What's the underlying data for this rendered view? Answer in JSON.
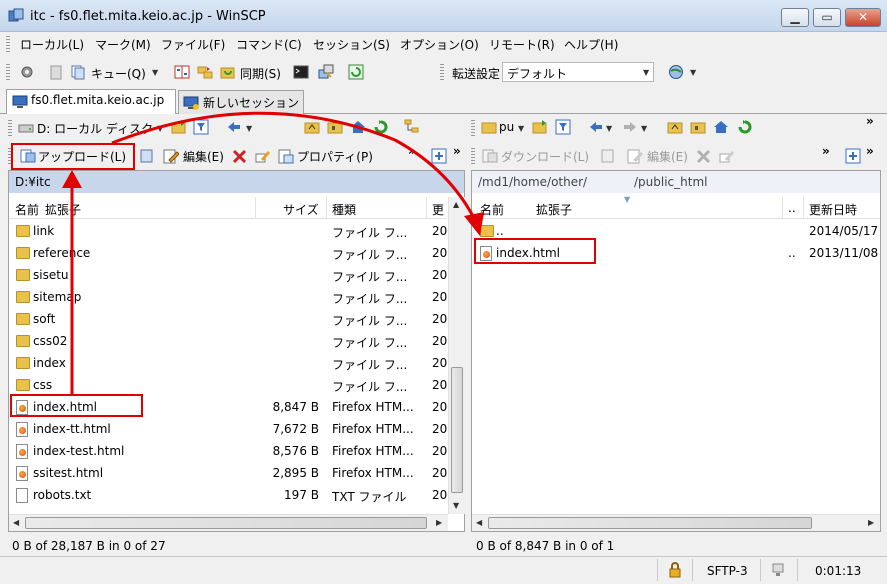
{
  "window": {
    "title": "itc - fs0.flet.mita.keio.ac.jp - WinSCP",
    "min_label": "▁",
    "max_label": "▭",
    "close_label": "✕"
  },
  "menu": [
    "ローカル(L)",
    "マーク(M)",
    "ファイル(F)",
    "コマンド(C)",
    "セッション(S)",
    "オプション(O)",
    "リモート(R)",
    "ヘルプ(H)"
  ],
  "toolbar": {
    "queue_label": "キュー(Q)",
    "sync_label": "同期(S)",
    "transfer_label": "転送設定",
    "transfer_value": "デフォルト"
  },
  "tabs": {
    "session": "fs0.flet.mita.keio.ac.jp",
    "new_session": "新しいセッション"
  },
  "local": {
    "drive": "D: ローカル ディスク",
    "upload_label": "アップロード(L)",
    "edit_label": "編集(E)",
    "props_label": "プロパティ(P)",
    "path": "D:¥itc",
    "columns": {
      "name": "名前",
      "ext": "拡張子",
      "size": "サイズ",
      "type": "種類",
      "changed": "更"
    },
    "files": [
      {
        "name": "link",
        "size": "",
        "type": "ファイル フ...",
        "changed": "20",
        "icon": "folder"
      },
      {
        "name": "reference",
        "size": "",
        "type": "ファイル フ...",
        "changed": "20",
        "icon": "folder"
      },
      {
        "name": "sisetu",
        "size": "",
        "type": "ファイル フ...",
        "changed": "20",
        "icon": "folder"
      },
      {
        "name": "sitemap",
        "size": "",
        "type": "ファイル フ...",
        "changed": "20",
        "icon": "folder"
      },
      {
        "name": "soft",
        "size": "",
        "type": "ファイル フ...",
        "changed": "20",
        "icon": "folder"
      },
      {
        "name": "css02",
        "size": "",
        "type": "ファイル フ...",
        "changed": "20",
        "icon": "folder"
      },
      {
        "name": "index",
        "size": "",
        "type": "ファイル フ...",
        "changed": "20",
        "icon": "folder"
      },
      {
        "name": "css",
        "size": "",
        "type": "ファイル フ...",
        "changed": "20",
        "icon": "folder"
      },
      {
        "name": "index.html",
        "size": "8,847 B",
        "type": "Firefox HTM...",
        "changed": "20",
        "icon": "html"
      },
      {
        "name": "index-tt.html",
        "size": "7,672 B",
        "type": "Firefox HTM...",
        "changed": "20",
        "icon": "html"
      },
      {
        "name": "index-test.html",
        "size": "8,576 B",
        "type": "Firefox HTM...",
        "changed": "20",
        "icon": "html"
      },
      {
        "name": "ssitest.html",
        "size": "2,895 B",
        "type": "Firefox HTM...",
        "changed": "20",
        "icon": "html"
      },
      {
        "name": "robots.txt",
        "size": "197 B",
        "type": "TXT ファイル",
        "changed": "20",
        "icon": "text"
      }
    ],
    "status": "0 B of 28,187 B in 0 of 27"
  },
  "remote": {
    "dir": "pu",
    "download_label": "ダウンロード(L)",
    "edit_label": "編集(E)",
    "path_part1": "/md1/home/other/",
    "path_part2": "/public_html",
    "columns": {
      "name": "名前",
      "ext": "拡張子",
      "dots": "..",
      "changed": "更新日時"
    },
    "files": [
      {
        "name": "..",
        "dots": "",
        "changed": "2014/05/17",
        "icon": "up"
      },
      {
        "name": "index.html",
        "dots": "..",
        "changed": "2013/11/08",
        "icon": "html"
      }
    ],
    "status": "0 B of 8,847 B in 0 of 1"
  },
  "statusbar": {
    "protocol": "SFTP-3",
    "time": "0:01:13"
  },
  "colors": {
    "annotation": "#e00000",
    "path_bar_local": "#c7d6ea",
    "path_bar_remote": "#eef2f8"
  }
}
